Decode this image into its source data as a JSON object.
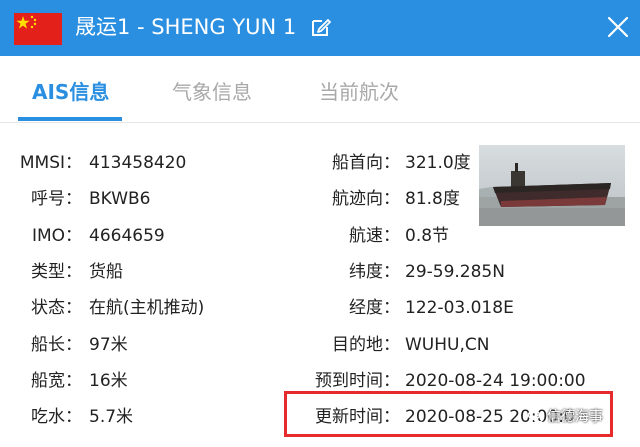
{
  "header": {
    "title": "晟运1 -  SHENG YUN 1",
    "flag_icon": "china-flag-icon",
    "edit_icon": "edit-icon",
    "close_icon": "close-icon",
    "bar_color": "#2a8fe0"
  },
  "tabs": [
    {
      "label": "AIS信息",
      "active": true
    },
    {
      "label": "气象信息",
      "active": false
    },
    {
      "label": "当前航次",
      "active": false
    }
  ],
  "left_fields": [
    {
      "label": "MMSI：",
      "value": "413458420"
    },
    {
      "label": "呼号：",
      "value": "BKWB6"
    },
    {
      "label": "IMO：",
      "value": "4664659"
    },
    {
      "label": "类型：",
      "value": "货船"
    },
    {
      "label": "状态：",
      "value": "在航(主机推动)"
    },
    {
      "label": "船长：",
      "value": "97米"
    },
    {
      "label": "船宽：",
      "value": "16米"
    },
    {
      "label": "吃水：",
      "value": "5.7米"
    }
  ],
  "right_fields": [
    {
      "label": "船首向：",
      "value": "321.0度"
    },
    {
      "label": "航迹向：",
      "value": "81.8度"
    },
    {
      "label": "航速：",
      "value": "0.8节"
    },
    {
      "label": "纬度：",
      "value": "29-59.285N"
    },
    {
      "label": "经度：",
      "value": "122-03.018E"
    },
    {
      "label": "目的地：",
      "value": "WUHU,CN"
    },
    {
      "label": "预到时间：",
      "value": "2020-08-24 19:00:00"
    },
    {
      "label": "更新时间：",
      "value": "2020-08-25 20:00:0"
    }
  ],
  "watermark": {
    "text": "信德海事",
    "icon": "wechat-icon"
  },
  "highlight_color": "#e52b2b"
}
